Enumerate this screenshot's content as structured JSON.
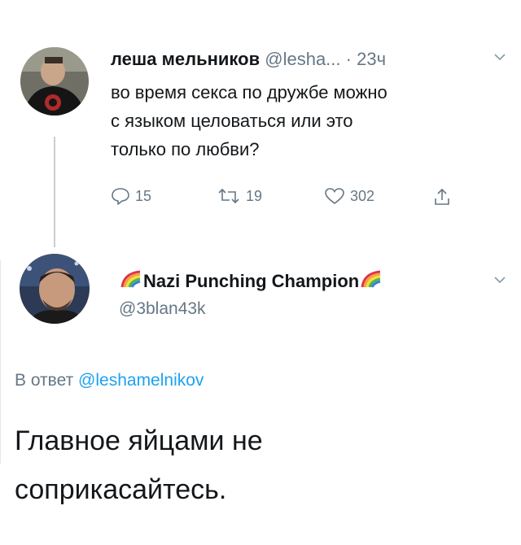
{
  "tweet": {
    "author_name": "леша мельников",
    "author_handle": "@lesha...",
    "separator": "·",
    "time": "23ч",
    "text_lines": [
      "во время секса по дружбе можно",
      "с языком целоваться или это",
      "только по любви?"
    ],
    "replies": "15",
    "retweets": "19",
    "likes": "302"
  },
  "reply": {
    "author_name": "Nazi Punching Champion",
    "author_handle": "@3blan43k",
    "reply_prefix": "В ответ",
    "reply_mention": "@leshamelnikov",
    "text_lines": [
      "Главное яйцами не",
      "соприкасайтесь."
    ]
  },
  "icons": {
    "reply": "reply-icon",
    "retweet": "retweet-icon",
    "like": "heart-icon",
    "share": "share-icon",
    "more": "chevron-down-icon",
    "rainbow": "rainbow-emoji-icon"
  },
  "colors": {
    "text": "#14171a",
    "secondary": "#657786",
    "link": "#1da1f2",
    "thread_line": "#c8ced3"
  }
}
